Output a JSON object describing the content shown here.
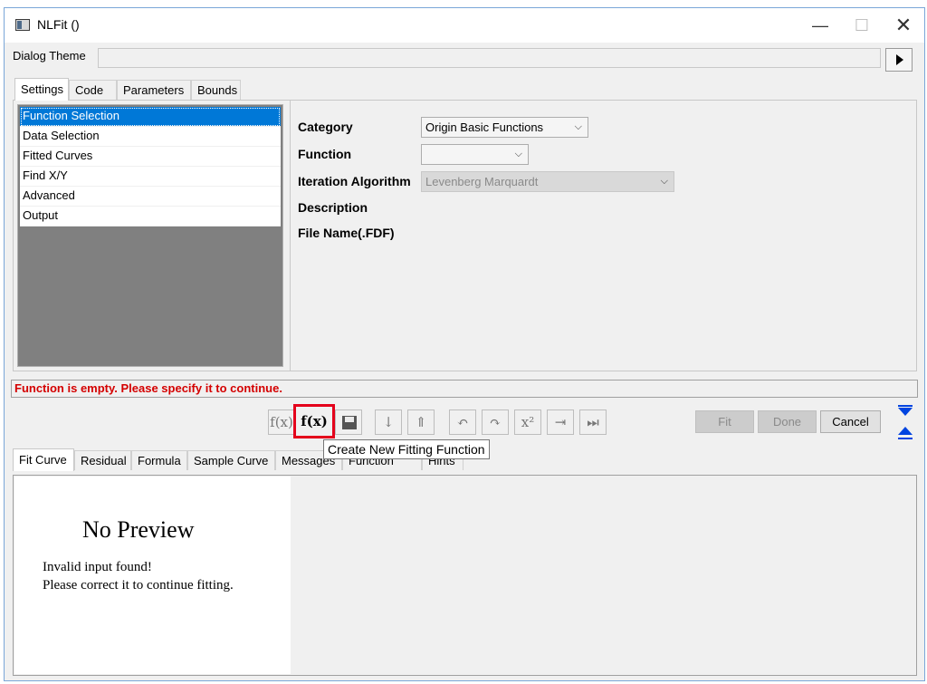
{
  "window": {
    "title": "NLFit ()",
    "min_glyph": "—",
    "max_glyph": "☐",
    "close_glyph": "✕"
  },
  "dialog_theme": {
    "label": "Dialog Theme",
    "value": ""
  },
  "top_tabs": [
    {
      "label": "Settings",
      "active": true
    },
    {
      "label": "Code"
    },
    {
      "label": "Parameters"
    },
    {
      "label": "Bounds"
    }
  ],
  "nav_items": [
    "Function Selection",
    "Data Selection",
    "Fitted Curves",
    "Find X/Y",
    "Advanced",
    "Output"
  ],
  "settings": {
    "category_label": "Category",
    "category_value": "Origin Basic Functions",
    "function_label": "Function",
    "function_value": "",
    "iteration_label": "Iteration Algorithm",
    "iteration_value": "Levenberg Marquardt",
    "description_label": "Description",
    "filename_label": "File Name(.FDF)"
  },
  "status_message": "Function is empty. Please specify it to continue.",
  "toolbar": {
    "glyphs": [
      "f(x)",
      "f(x)",
      "",
      "↓",
      "⇑",
      "↶",
      "↷",
      "x²",
      "⇥",
      "⏭"
    ],
    "tooltip": "Create New Fitting Function"
  },
  "buttons": {
    "fit": "Fit",
    "done": "Done",
    "cancel": "Cancel"
  },
  "bottom_tabs": [
    {
      "label": "Fit Curve",
      "active": true
    },
    {
      "label": "Residual"
    },
    {
      "label": "Formula"
    },
    {
      "label": "Sample Curve"
    },
    {
      "label": "Messages"
    },
    {
      "label": "Function File"
    },
    {
      "label": "Hints"
    }
  ],
  "preview": {
    "title": "No Preview",
    "line1": "Invalid input found!",
    "line2": "Please correct it to continue fitting."
  },
  "colors": {
    "accent": "#0078d7",
    "error": "#d40000",
    "highlight": "#e4001b",
    "arrows": "#0044e0"
  }
}
